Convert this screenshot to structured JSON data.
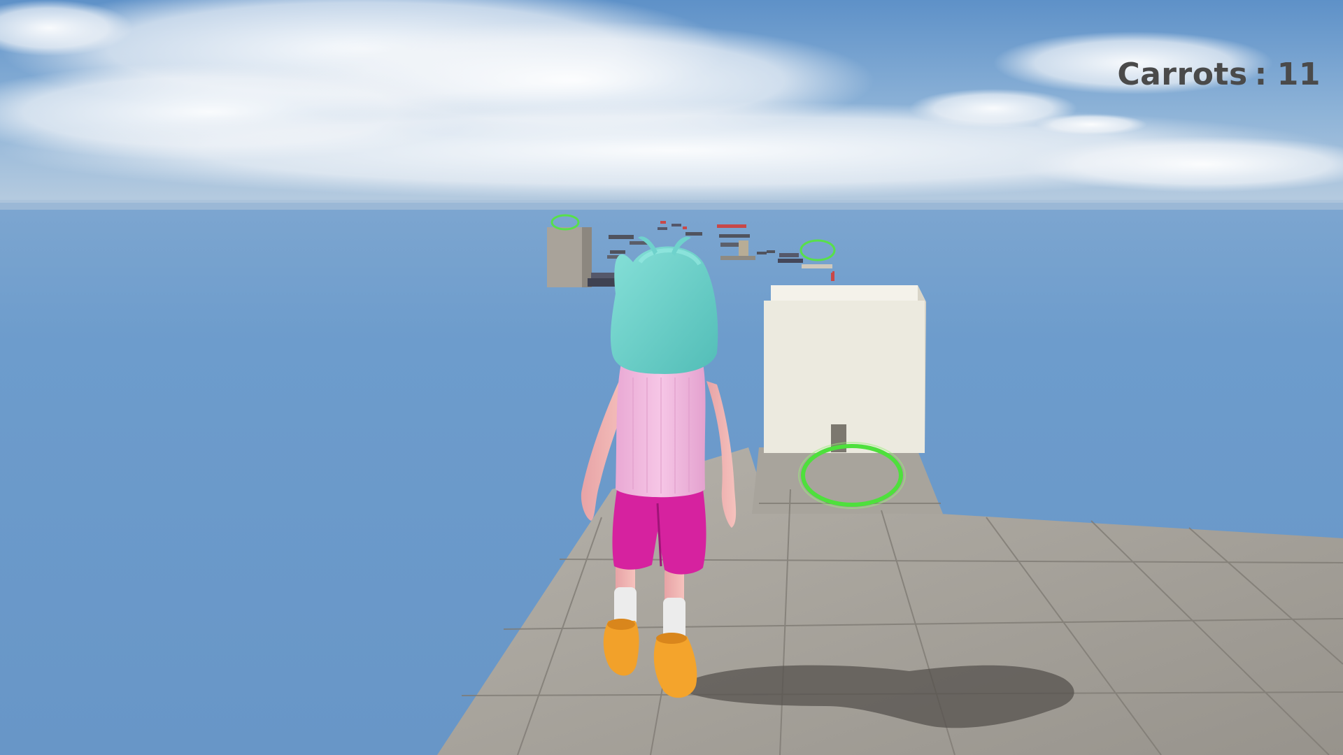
{
  "hud": {
    "carrots_label": "Carrots",
    "separator": ":",
    "carrots_count": "11"
  },
  "colors": {
    "sky_top": "#5f92c9",
    "ocean": "#6a9ccc",
    "hud_text": "#4a4a4a",
    "ring": "#58e04a",
    "hair": "#6fd2cc",
    "shirt": "#f0b8de",
    "shorts": "#d6229f",
    "boots": "#f2a12a",
    "skin": "#f3b6b4",
    "floor": "#a9a59e",
    "white_block": "#eeebdf"
  },
  "scene": {
    "character": "player-character",
    "collectibles": [
      "goal-ring",
      "goal-ring",
      "goal-ring"
    ],
    "objects": [
      "white-block",
      "stone-platform",
      "floating-course"
    ]
  }
}
